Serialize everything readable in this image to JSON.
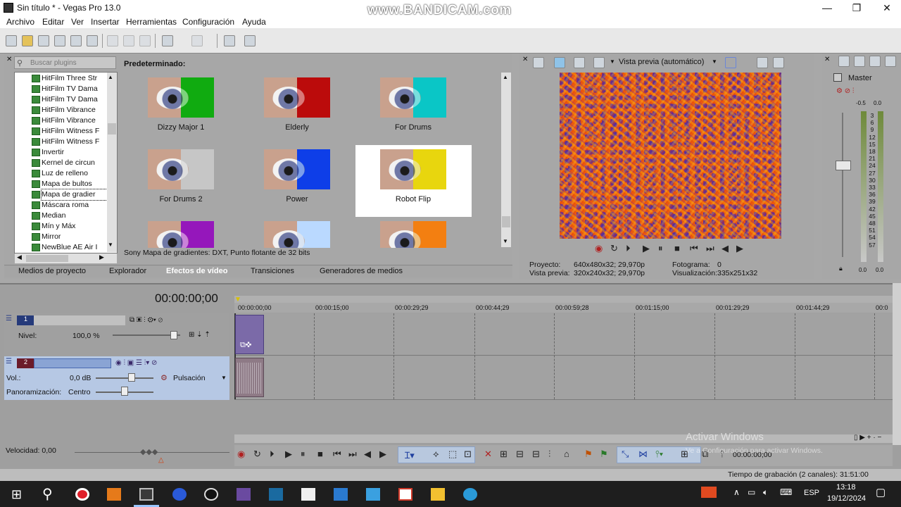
{
  "window": {
    "title": "Sin título * - Vegas Pro 13.0",
    "watermark": "www.BANDICAM.com",
    "controls": [
      "—",
      "❐",
      "✕"
    ]
  },
  "menu": [
    "Archivo",
    "Editar",
    "Ver",
    "Insertar",
    "Herramientas",
    "Configuración",
    "Ayuda"
  ],
  "plugins": {
    "search_placeholder": "Buscar plugins",
    "items": [
      "HitFilm Three Str",
      "HitFilm TV Dama",
      "HitFilm TV Dama",
      "HitFilm Vibrance",
      "HitFilm Vibrance",
      "HitFilm Witness F",
      "HitFilm Witness F",
      "Invertir",
      "Kernel de circun",
      "Luz de relleno",
      "Mapa de bultos",
      "Mapa de gradier",
      "Máscara roma",
      "Median",
      "Mín y Máx",
      "Mirror",
      "NewBlue AE Air I"
    ],
    "selected_index": 11
  },
  "presets": {
    "header": "Predeterminado:",
    "items": [
      "Dizzy Major 1",
      "Elderly",
      "For Drums",
      "For Drums 2",
      "Power",
      "Robot Flip"
    ],
    "selected": "Robot Flip",
    "status": "Sony Mapa de gradientes: DXT, Punto flotante de 32 bits",
    "colors": [
      "#1ec41e",
      "#d01515",
      "#14d8d8",
      "#d8d8d8",
      "#1a5ef0",
      "#f0e41a",
      "#b22ad0",
      "#cfe6ff",
      "#f7a020"
    ]
  },
  "tabs": [
    "Medios de proyecto",
    "Explorador",
    "Efectos de vídeo",
    "Transiciones",
    "Generadores de medios"
  ],
  "active_tab": "Efectos de vídeo",
  "preview": {
    "mode": "Vista previa (automático)",
    "proyecto_label": "Proyecto:",
    "proyecto_value": "640x480x32; 29,970p",
    "vista_label": "Vista previa:",
    "vista_value": "320x240x32; 29,970p",
    "fotograma_label": "Fotograma:",
    "fotograma_value": "0",
    "visualizacion_label": "Visualización:",
    "visualizacion_value": "335x251x32"
  },
  "master": {
    "label": "Master",
    "top_ticks": [
      "-0.5",
      "0.0"
    ],
    "scale": [
      "3",
      "6",
      "9",
      "12",
      "15",
      "18",
      "21",
      "24",
      "27",
      "30",
      "33",
      "36",
      "39",
      "42",
      "45",
      "48",
      "51",
      "54",
      "57"
    ],
    "bottom_values": [
      "0.0",
      "0.0"
    ]
  },
  "timeline": {
    "timecode": "00:00:00;00",
    "ruler": [
      "00:00:00;00",
      "00:00:15;00",
      "00:00:29;29",
      "00:00:44;29",
      "00:00:59;28",
      "00:01:15;00",
      "00:01:29;29",
      "00:01:44;29",
      "00:0"
    ],
    "track1": {
      "number": "1",
      "level_label": "Nivel:",
      "level_value": "100,0 %"
    },
    "track2": {
      "number": "2",
      "vol_label": "Vol.:",
      "vol_value": "0,0 dB",
      "mode": "Pulsación",
      "pan_label": "Panoramización:",
      "pan_value": "Centro"
    },
    "speed": "Velocidad: 0,00",
    "bottom_timecode": "00:00:00;00",
    "watermark_line1": "Activar Windows",
    "watermark_line2": "Ve a Configuración para activar Windows."
  },
  "status": "Tiempo de grabación (2 canales): 31:51:00",
  "taskbar": {
    "lang": "ESP",
    "time": "13:18",
    "date": "19/12/2024"
  }
}
